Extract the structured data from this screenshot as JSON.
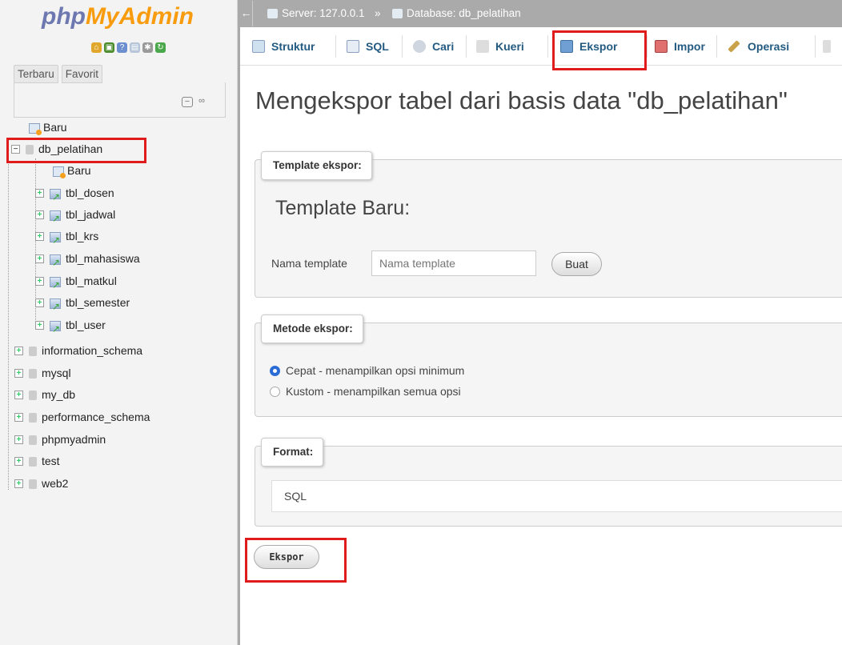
{
  "app": {
    "logo_php": "php",
    "logo_my": "MyAdmin"
  },
  "nav": {
    "tabs": [
      "Terbaru",
      "Favorit"
    ],
    "tree": [
      {
        "label": "Baru",
        "type": "new"
      },
      {
        "label": "db_pelatihan",
        "type": "db"
      },
      {
        "label": "Baru",
        "type": "new"
      },
      {
        "label": "tbl_dosen",
        "type": "table"
      },
      {
        "label": "tbl_jadwal",
        "type": "table"
      },
      {
        "label": "tbl_krs",
        "type": "table"
      },
      {
        "label": "tbl_mahasiswa",
        "type": "table"
      },
      {
        "label": "tbl_matkul",
        "type": "table"
      },
      {
        "label": "tbl_semester",
        "type": "table"
      },
      {
        "label": "tbl_user",
        "type": "table"
      },
      {
        "label": "information_schema",
        "type": "db"
      },
      {
        "label": "mysql",
        "type": "db"
      },
      {
        "label": "my_db",
        "type": "db"
      },
      {
        "label": "performance_schema",
        "type": "db"
      },
      {
        "label": "phpmyadmin",
        "type": "db"
      },
      {
        "label": "test",
        "type": "db"
      },
      {
        "label": "web2",
        "type": "db"
      }
    ]
  },
  "breadcrumb": {
    "server": "Server: 127.0.0.1",
    "separator": "»",
    "database": "Database: db_pelatihan"
  },
  "tabs": [
    "Struktur",
    "SQL",
    "Cari",
    "Kueri",
    "Ekspor",
    "Impor",
    "Operasi"
  ],
  "active_tab": "Ekspor",
  "page": {
    "title": "Mengekspor tabel dari basis data \"db_pelatihan\""
  },
  "template_section": {
    "legend": "Template ekspor:",
    "heading": "Template Baru:",
    "name_label": "Nama template",
    "name_placeholder": "Nama template",
    "create_button": "Buat"
  },
  "method_section": {
    "legend": "Metode ekspor:",
    "options": [
      "Cepat - menampilkan opsi minimum",
      "Kustom - menampilkan semua opsi"
    ],
    "selected": "Cepat - menampilkan opsi minimum"
  },
  "format_section": {
    "legend": "Format:",
    "selected": "SQL"
  },
  "export_button": "Ekspor",
  "colors": {
    "highlight": "#e01b1b",
    "link": "#235a81",
    "logo_php": "#6c78af",
    "logo_myadmin": "#f89c0e"
  }
}
